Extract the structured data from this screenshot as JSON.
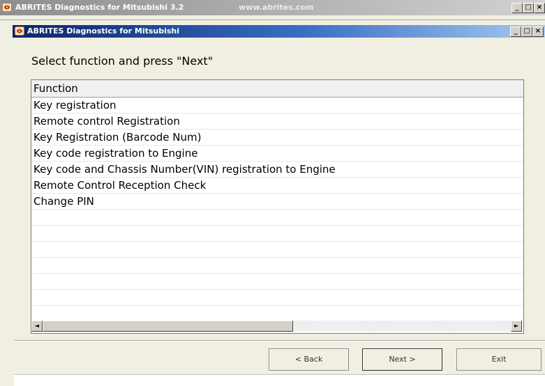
{
  "outer_window": {
    "title": "ABRITES Diagnostics for Mitsubishi 3.2",
    "url_text": "www.abrites.com",
    "min_label": "_",
    "max_label": "□",
    "close_label": "×"
  },
  "inner_window": {
    "title": "ABRITES Diagnostics for Mitsubishi",
    "min_label": "_",
    "max_label": "□",
    "close_label": "×"
  },
  "instruction": "Select function and press \"Next\"",
  "list": {
    "column_header": "Function",
    "items": [
      "Key registration",
      "Remote control Registration",
      "Key Registration (Barcode Num)",
      "Key code registration to Engine",
      "Key code and Chassis Number(VIN) registration to Engine",
      "Remote Control Reception Check",
      "Change PIN"
    ]
  },
  "scrollbar": {
    "left_arrow": "◄",
    "right_arrow": "►"
  },
  "buttons": {
    "back": "< Back",
    "next": "Next >",
    "exit": "Exit"
  }
}
